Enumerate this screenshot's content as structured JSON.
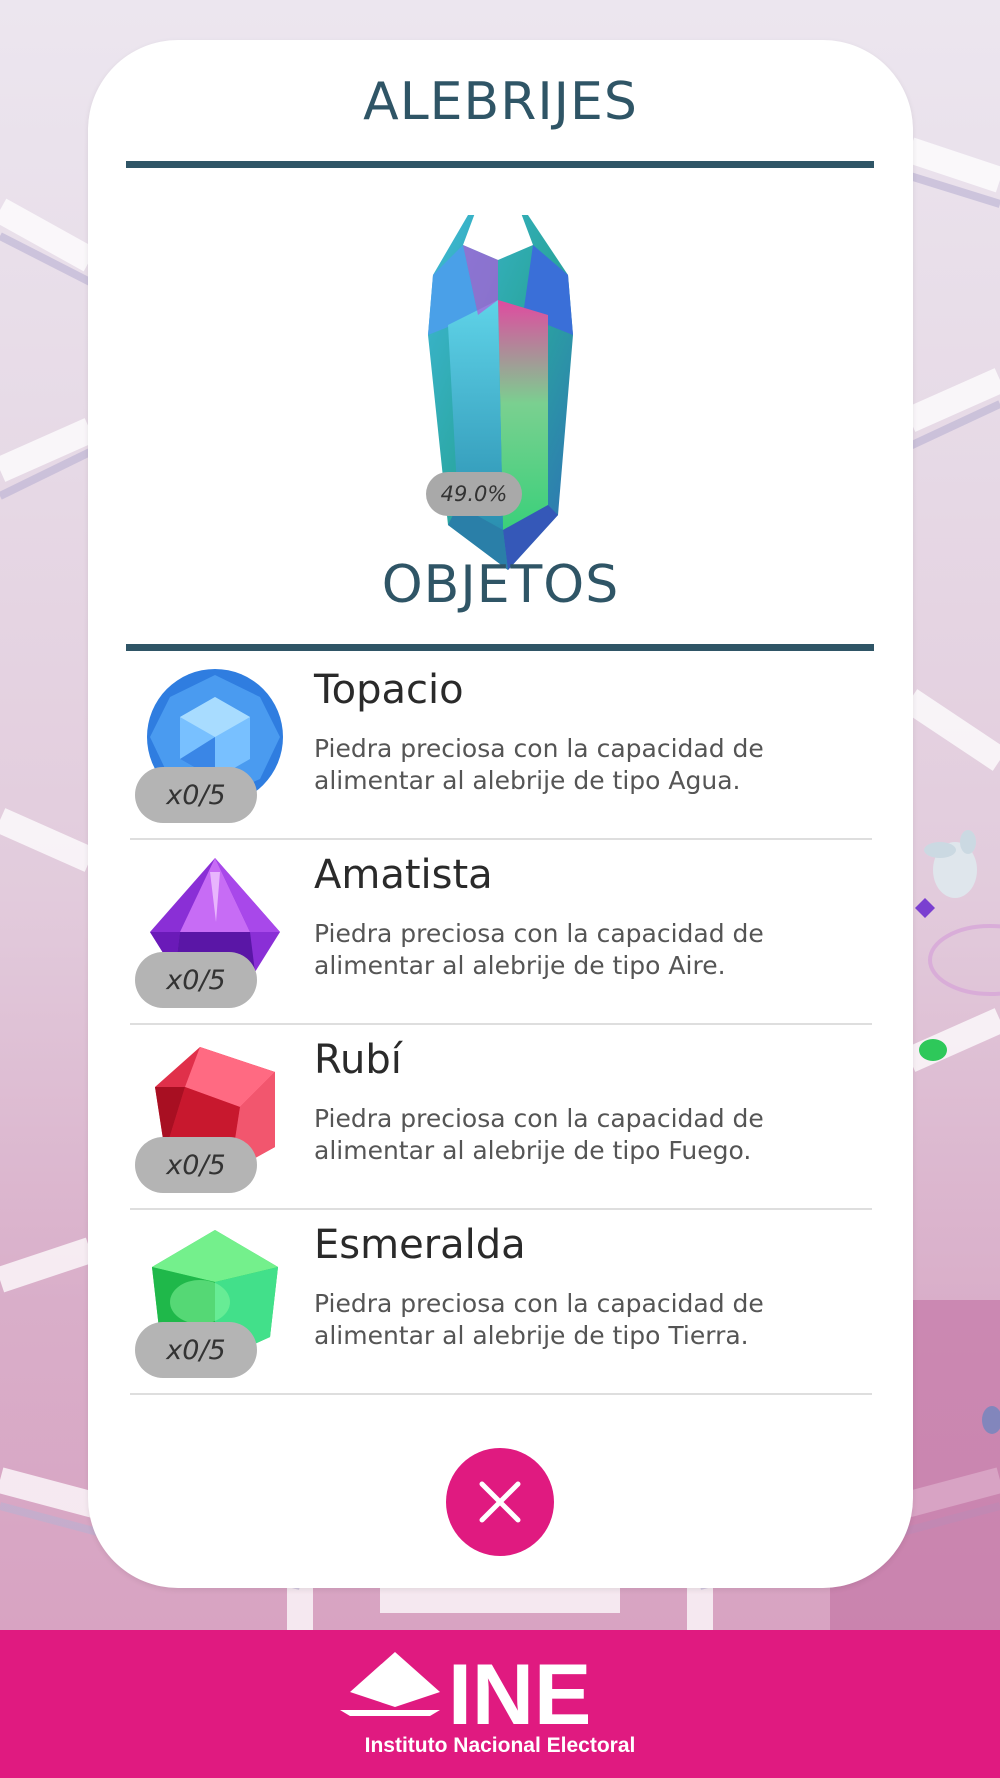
{
  "header": {
    "title": "ALEBRIJES"
  },
  "alebrije": {
    "progress": "49.0%",
    "icon": "crystal-icon"
  },
  "objects": {
    "title": "OBJETOS",
    "items": [
      {
        "name": "Topacio",
        "description": "Piedra preciosa con la capacidad de alimentar al alebrije de tipo Agua.",
        "count": "x0/5",
        "icon": "topaz-gem-icon",
        "color": "#2f7de0"
      },
      {
        "name": "Amatista",
        "description": "Piedra preciosa con la capacidad de alimentar al alebrije de tipo Aire.",
        "count": "x0/5",
        "icon": "amethyst-gem-icon",
        "color": "#8a2fd6"
      },
      {
        "name": "Rubí",
        "description": "Piedra preciosa con la capacidad de alimentar al alebrije de tipo Fuego.",
        "count": "x0/5",
        "icon": "ruby-gem-icon",
        "color": "#e0304a"
      },
      {
        "name": "Esmeralda",
        "description": "Piedra preciosa con la capacidad de alimentar al alebrije de tipo Tierra.",
        "count": "x0/5",
        "icon": "emerald-gem-icon",
        "color": "#2ed15a"
      }
    ]
  },
  "close_button": {
    "icon": "close-icon",
    "color": "#e01a80"
  },
  "footer": {
    "logo_text": "INE",
    "subtitle": "Instituto Nacional Electoral",
    "color": "#e01a80"
  }
}
